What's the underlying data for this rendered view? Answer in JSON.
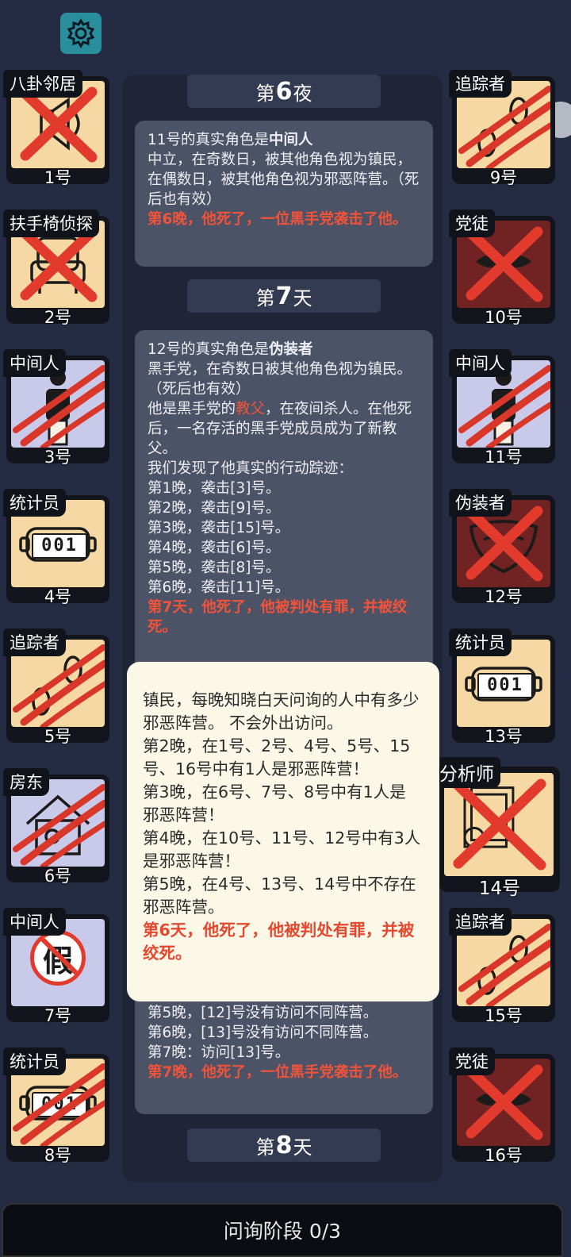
{
  "settings_label": "settings",
  "colors": {
    "accent": "#2a8f9d",
    "red_text": "#f0533a",
    "card_cream": "#f5d8a3",
    "card_purple": "#c9c9ea",
    "card_maroon": "#702322"
  },
  "log": {
    "night6": {
      "prefix": "第",
      "num": "6",
      "suffix": "夜"
    },
    "msg1": {
      "title_plain": "11号的真实角色是",
      "title_bold": "中间人",
      "body": "中立，在奇数日，被其他角色视为镇民，在偶数日，被其他角色视为邪恶阵营。（死后也有效）",
      "death": "第6晚，他死了，一位黑手党袭击了他。"
    },
    "day7": {
      "prefix": "第",
      "num": "7",
      "suffix": "天"
    },
    "msg2": {
      "title_plain": "12号的真实角色是",
      "title_bold": "伪装者",
      "body1": "黑手党，在奇数日被其他角色视为镇民。（死后也有效）",
      "body2_a": "他是黑手党的",
      "body2_hl": "教父",
      "body2_b": "，在夜间杀人。在他死后，一名存活的黑手党成员成为了新教父。",
      "body3": "我们发现了他真实的行动踪迹：",
      "nights": [
        "第1晚，袭击[3]号。",
        "第2晚，袭击[9]号。",
        "第3晚，袭击[15]号。",
        "第4晚，袭击[6]号。",
        "第5晚，袭击[8]号。",
        "第6晚，袭击[11]号。"
      ],
      "death": "第7天，他死了，他被判处有罪，并被绞死。"
    },
    "msg3": {
      "lines": [
        "第5晚，[12]号没有访问不同阵营。",
        "第6晚，[13]号没有访问不同阵营。",
        "第7晚：访问[13]号。"
      ],
      "death": "第7晚，他死了，一位黑手党袭击了他。"
    },
    "day8": {
      "prefix": "第",
      "num": "8",
      "suffix": "天"
    }
  },
  "popup": {
    "desc": "镇民，每晚知晓白天问询的人中有多少邪恶阵营。 不会外出访问。",
    "lines": [
      "第2晚，在1号、2号、4号、5号、15号、16号中有1人是邪恶阵营！",
      "第3晚，在6号、7号、8号中有1人是邪恶阵营！",
      "第4晚，在10号、11号、12号中有3人是邪恶阵营！",
      "第5晚，在4号、13号、14号中不存在邪恶阵营。"
    ],
    "death": "第6天，他死了，他被判处有罪，并被绞死。"
  },
  "players_left": [
    {
      "role": "八卦邻居",
      "number": "1号",
      "icon": "speaker-icon",
      "bg": "cream",
      "status": "x"
    },
    {
      "role": "扶手椅侦探",
      "number": "2号",
      "icon": "armchair-icon",
      "bg": "cream",
      "status": "x"
    },
    {
      "role": "中间人",
      "number": "3号",
      "icon": "person-icon",
      "bg": "purple",
      "status": "claw"
    },
    {
      "role": "统计员",
      "number": "4号",
      "icon": "counter-icon",
      "bg": "cream",
      "status": "alive"
    },
    {
      "role": "追踪者",
      "number": "5号",
      "icon": "footprints-icon",
      "bg": "cream",
      "status": "claw"
    },
    {
      "role": "房东",
      "number": "6号",
      "icon": "house-icon",
      "bg": "purple",
      "status": "claw"
    },
    {
      "role": "中间人",
      "number": "7号",
      "icon": "fake-icon",
      "bg": "purple",
      "status": "fake",
      "fake_char": "假"
    },
    {
      "role": "统计员",
      "number": "8号",
      "icon": "counter-icon",
      "bg": "cream",
      "status": "claw"
    }
  ],
  "players_right": [
    {
      "role": "追踪者",
      "number": "9号",
      "icon": "footprints-icon",
      "bg": "cream",
      "status": "claw"
    },
    {
      "role": "党徒",
      "number": "10号",
      "icon": "mustache-icon",
      "bg": "maroon",
      "status": "x"
    },
    {
      "role": "中间人",
      "number": "11号",
      "icon": "person-icon",
      "bg": "purple",
      "status": "claw"
    },
    {
      "role": "伪装者",
      "number": "12号",
      "icon": "mask-icon",
      "bg": "maroon",
      "status": "x"
    },
    {
      "role": "统计员",
      "number": "13号",
      "icon": "counter-icon",
      "bg": "cream",
      "status": "alive"
    },
    {
      "role": "分析师",
      "number": "14号",
      "icon": "documents-icon",
      "bg": "cream",
      "status": "x"
    },
    {
      "role": "追踪者",
      "number": "15号",
      "icon": "footprints-icon",
      "bg": "cream",
      "status": "claw"
    },
    {
      "role": "党徒",
      "number": "16号",
      "icon": "mustache-icon",
      "bg": "maroon",
      "status": "x"
    }
  ],
  "counter_digits": "001",
  "bottom_bar": {
    "label": "问询阶段 0/3"
  }
}
